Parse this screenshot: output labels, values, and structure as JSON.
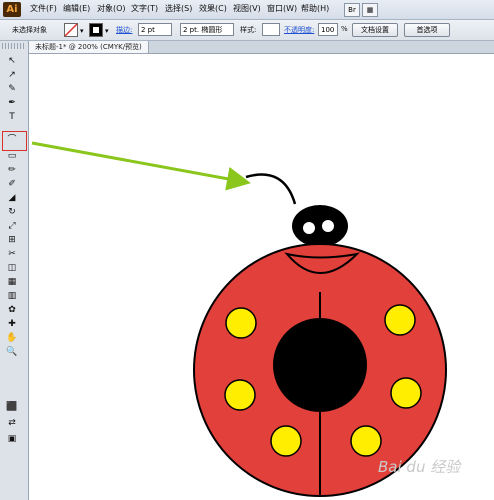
{
  "app": {
    "logo_text": "Ai"
  },
  "menu": [
    "文件(F)",
    "编辑(E)",
    "对象(O)",
    "文字(T)",
    "选择(S)",
    "效果(C)",
    "视图(V)",
    "窗口(W)",
    "帮助(H)"
  ],
  "controlbar": {
    "selection_label": "未选择对象",
    "stroke_label": "描边:",
    "stroke_weight": "2 pt",
    "brush_value": "2 pt. 椭圆形",
    "style_label": "样式:",
    "opacity_label": "不透明度:",
    "opacity_value": "100",
    "opacity_unit": "%",
    "doc_setup_button": "文档设置",
    "preferences_button": "首选项"
  },
  "document_tab": {
    "title": "未标题-1* @ 200% (CMYK/预览)"
  },
  "tools": [
    "↖",
    "↗",
    "✎",
    "✒",
    "T",
    "⌒",
    "▭",
    "✏",
    "✐",
    "◢",
    "↻",
    "⤢",
    "⊞",
    "✂",
    "◫",
    "▦",
    "▥",
    "✿",
    "✚",
    "✋",
    "🔍",
    "⬛",
    "⇄",
    "▣"
  ],
  "colors": {
    "ladybug_body": "#e2403a",
    "spots": "#ffee00",
    "head": "#000000",
    "mouth": "#e2403a",
    "arrow": "#8ac61c",
    "highlight_box": "#d9322a"
  },
  "watermark": "Bai du 经验"
}
